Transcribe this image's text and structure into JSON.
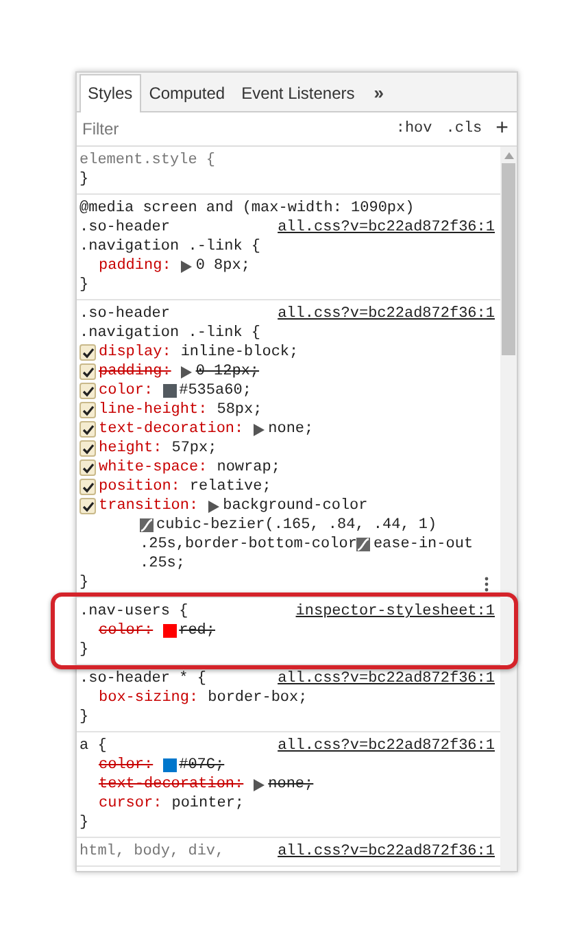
{
  "tabs": [
    {
      "label": "Styles",
      "selected": true
    },
    {
      "label": "Computed",
      "selected": false
    },
    {
      "label": "Event Listeners",
      "selected": false
    }
  ],
  "tabs_overflow": "»",
  "filter": {
    "placeholder": "Filter",
    "buttons": [
      ":hov",
      ".cls",
      "+"
    ]
  },
  "rules": [
    {
      "selector": [
        "element.style {"
      ],
      "muted": true,
      "highlighted": false,
      "has_menu": false,
      "close": "}"
    },
    {
      "selector": [
        "@media screen and (max-width: 1090px)",
        ".so-header",
        ".navigation .-link {"
      ],
      "source": "all.css?v=bc22ad872f36:1",
      "muted": false,
      "highlighted": false,
      "has_menu": false,
      "declarations": [
        {
          "property": "padding:",
          "overridden": false,
          "value": [
            [
              {
                "kind": "expander"
              },
              {
                "kind": "text",
                "text": "0 8px;"
              }
            ]
          ]
        }
      ],
      "close": "}"
    },
    {
      "selector": [
        ".so-header",
        ".navigation .-link {"
      ],
      "source": "all.css?v=bc22ad872f36:1",
      "muted": false,
      "highlighted": false,
      "has_menu": true,
      "declarations": [
        {
          "property": "display:",
          "overridden": false,
          "checked": true,
          "value": [
            [
              {
                "kind": "text",
                "text": "inline-block;"
              }
            ]
          ]
        },
        {
          "property": "padding:",
          "overridden": true,
          "checked": true,
          "value": [
            [
              {
                "kind": "expander"
              },
              {
                "kind": "text",
                "text": "0 12px;"
              }
            ]
          ]
        },
        {
          "property": "color:",
          "overridden": false,
          "checked": true,
          "value": [
            [
              {
                "kind": "swatch",
                "color": "#535a60"
              },
              {
                "kind": "text",
                "text": "#535a60;"
              }
            ]
          ]
        },
        {
          "property": "line-height:",
          "overridden": false,
          "checked": true,
          "value": [
            [
              {
                "kind": "text",
                "text": "58px;"
              }
            ]
          ]
        },
        {
          "property": "text-decoration:",
          "overridden": false,
          "checked": true,
          "value": [
            [
              {
                "kind": "expander"
              },
              {
                "kind": "text",
                "text": "none;"
              }
            ]
          ]
        },
        {
          "property": "height:",
          "overridden": false,
          "checked": true,
          "value": [
            [
              {
                "kind": "text",
                "text": "57px;"
              }
            ]
          ]
        },
        {
          "property": "white-space:",
          "overridden": false,
          "checked": true,
          "value": [
            [
              {
                "kind": "text",
                "text": "nowrap;"
              }
            ]
          ]
        },
        {
          "property": "position:",
          "overridden": false,
          "checked": true,
          "value": [
            [
              {
                "kind": "text",
                "text": "relative;"
              }
            ]
          ]
        },
        {
          "property": "transition:",
          "overridden": false,
          "checked": true,
          "value": [
            [
              {
                "kind": "expander"
              },
              {
                "kind": "text",
                "text": "background-color"
              }
            ],
            [
              {
                "kind": "curve"
              },
              {
                "kind": "text",
                "text": "cubic-bezier(.165, .84, .44, 1)"
              }
            ],
            [
              {
                "kind": "text",
                "text": ".25s,border-bottom-color"
              },
              {
                "kind": "curve"
              },
              {
                "kind": "text",
                "text": "ease-in-out"
              }
            ],
            [
              {
                "kind": "text",
                "text": ".25s;"
              }
            ]
          ]
        }
      ],
      "close": "}"
    },
    {
      "selector": [
        ".nav-users {"
      ],
      "source": "inspector-stylesheet:1",
      "muted": false,
      "highlighted": true,
      "has_menu": false,
      "declarations": [
        {
          "property": "color:",
          "overridden": true,
          "value": [
            [
              {
                "kind": "swatch",
                "color": "#ff0000"
              },
              {
                "kind": "text",
                "text": "red;"
              }
            ]
          ]
        }
      ],
      "close": "}"
    },
    {
      "selector": [
        ".so-header * {"
      ],
      "source": "all.css?v=bc22ad872f36:1",
      "muted": false,
      "highlighted": false,
      "has_menu": false,
      "declarations": [
        {
          "property": "box-sizing:",
          "overridden": false,
          "value": [
            [
              {
                "kind": "text",
                "text": "border-box;"
              }
            ]
          ]
        }
      ],
      "close": "}"
    },
    {
      "selector": [
        "a {"
      ],
      "source": "all.css?v=bc22ad872f36:1",
      "muted": false,
      "highlighted": false,
      "has_menu": false,
      "declarations": [
        {
          "property": "color:",
          "overridden": true,
          "value": [
            [
              {
                "kind": "swatch",
                "color": "#0077cc"
              },
              {
                "kind": "text",
                "text": "#07C;"
              }
            ]
          ]
        },
        {
          "property": "text-decoration:",
          "overridden": true,
          "value": [
            [
              {
                "kind": "expander"
              },
              {
                "kind": "text",
                "text": "none;"
              }
            ]
          ]
        },
        {
          "property": "cursor:",
          "overridden": false,
          "value": [
            [
              {
                "kind": "text",
                "text": "pointer;"
              }
            ]
          ]
        }
      ],
      "close": "}"
    },
    {
      "selector": [
        "html, body, div,"
      ],
      "source": "all.css?v=bc22ad872f36:1",
      "muted": true,
      "highlighted": false,
      "has_menu": false
    }
  ]
}
